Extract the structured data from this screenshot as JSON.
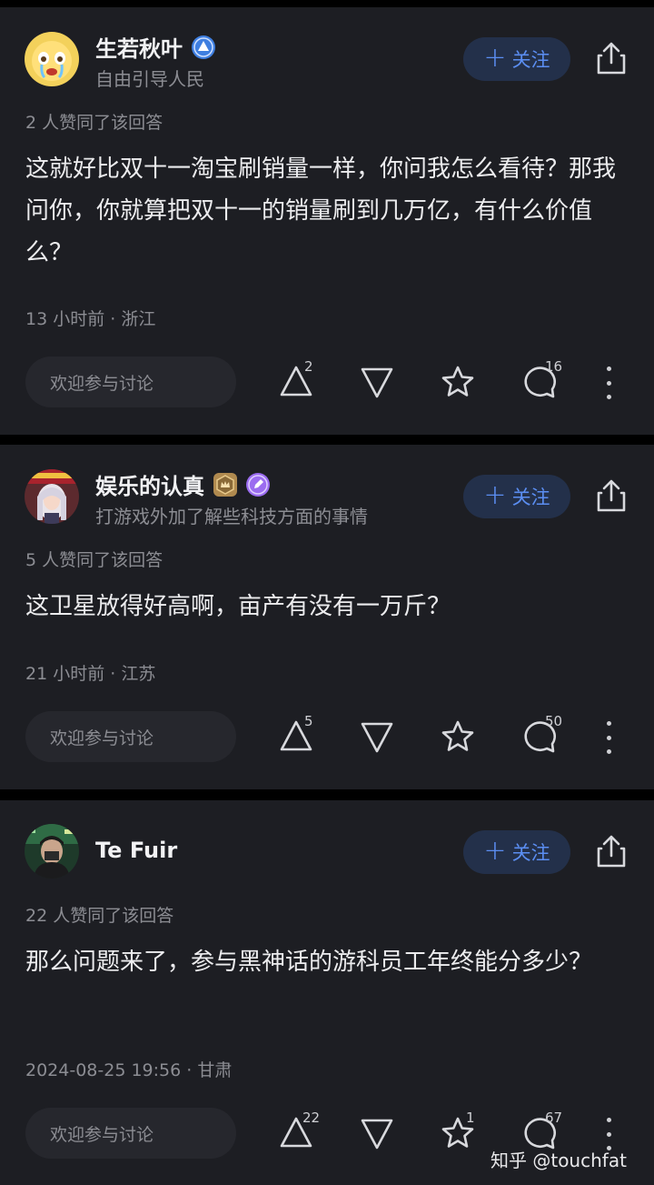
{
  "answers": [
    {
      "author": "生若秋叶",
      "bio": "自由引导人民",
      "follow_label": "关注",
      "agree_text": "2 人赞同了该回答",
      "content": "这就好比双十一淘宝刷销量一样，你问我怎么看待？那我问你，你就算把双十一的销量刷到几万亿，有什么价值么？",
      "meta": "13 小时前 · 浙江",
      "discuss_placeholder": "欢迎参与讨论",
      "upvotes": "2",
      "favorites": "",
      "comments": "16"
    },
    {
      "author": "娱乐的认真",
      "bio": "打游戏外加了解些科技方面的事情",
      "follow_label": "关注",
      "agree_text": "5 人赞同了该回答",
      "content": "这卫星放得好高啊，亩产有没有一万斤？",
      "meta": "21 小时前 · 江苏",
      "discuss_placeholder": "欢迎参与讨论",
      "upvotes": "5",
      "favorites": "",
      "comments": "50"
    },
    {
      "author": "Te Fuir",
      "bio": "",
      "follow_label": "关注",
      "agree_text": "22 人赞同了该回答",
      "content": "那么问题来了，参与黑神话的游科员工年终能分多少？",
      "meta": "2024-08-25 19:56 · 甘肃",
      "discuss_placeholder": "欢迎参与讨论",
      "upvotes": "22",
      "favorites": "1",
      "comments": "67"
    }
  ],
  "watermark": "知乎 @touchfat",
  "colors": {
    "card_bg": "#1d1e23",
    "accent": "#5b8ef2",
    "muted_text": "#8c8d93",
    "verified_badge": "#3f7fe0",
    "creator_badge": "#9b6cf0",
    "level_badge": "#b08a4f"
  }
}
